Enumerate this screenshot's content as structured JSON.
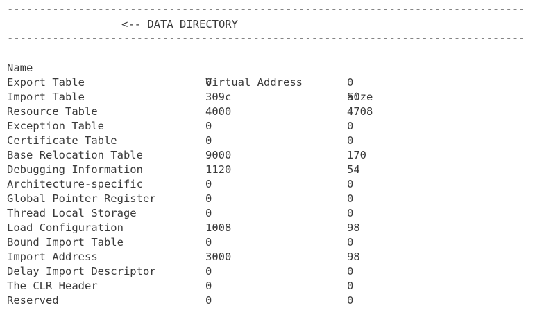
{
  "divider": "-----------------------------------------------------------------------------------------------------------------",
  "section_title": "<-- DATA DIRECTORY",
  "headers": {
    "name": "Name",
    "virtual_address": "Virtual Address",
    "size": "Size"
  },
  "rows": [
    {
      "name": "Export Table",
      "va": "0",
      "size": "0"
    },
    {
      "name": "Import Table",
      "va": "309c",
      "size": "a0"
    },
    {
      "name": "Resource Table",
      "va": "4000",
      "size": "4708"
    },
    {
      "name": "Exception Table",
      "va": "0",
      "size": "0"
    },
    {
      "name": "Certificate Table",
      "va": "0",
      "size": "0"
    },
    {
      "name": "Base Relocation Table",
      "va": "9000",
      "size": "170"
    },
    {
      "name": "Debugging Information",
      "va": "1120",
      "size": "54"
    },
    {
      "name": "Architecture-specific",
      "va": "0",
      "size": "0"
    },
    {
      "name": "Global Pointer Register",
      "va": "0",
      "size": "0"
    },
    {
      "name": "Thread Local Storage",
      "va": "0",
      "size": "0"
    },
    {
      "name": "Load Configuration",
      "va": "1008",
      "size": "98"
    },
    {
      "name": "Bound Import Table",
      "va": "0",
      "size": "0"
    },
    {
      "name": "Import Address",
      "va": "3000",
      "size": "98"
    },
    {
      "name": "Delay Import Descriptor",
      "va": "0",
      "size": "0"
    },
    {
      "name": "The CLR Header",
      "va": "0",
      "size": "0"
    },
    {
      "name": "Reserved",
      "va": "0",
      "size": "0"
    }
  ]
}
